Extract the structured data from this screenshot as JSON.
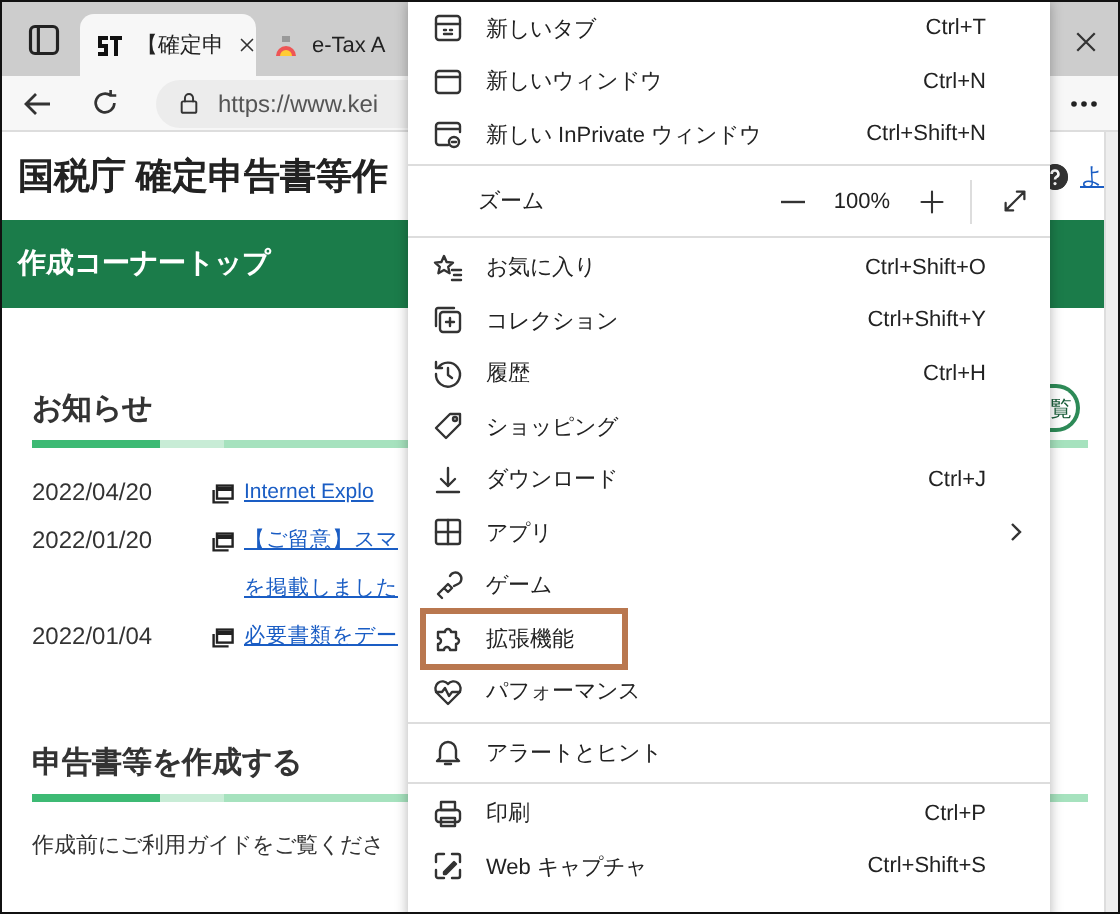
{
  "browser": {
    "tabs": [
      {
        "title": "【確定申",
        "selected": true
      },
      {
        "title": "e-Tax A",
        "selected": false
      }
    ],
    "url": "https://www.kei"
  },
  "page": {
    "title": "国税庁 確定申告書等作",
    "help_link": "よ",
    "banner": "作成コーナートップ",
    "news": {
      "heading": "お知らせ",
      "button": "覧",
      "items": [
        {
          "date": "2022/04/20",
          "lines": [
            "Internet Explo"
          ]
        },
        {
          "date": "2022/01/20",
          "lines": [
            "【ご留意】スマ",
            "を掲載しました"
          ]
        },
        {
          "date": "2022/01/04",
          "lines": [
            "必要書類をデー"
          ]
        }
      ]
    },
    "create": {
      "heading": "申告書等を作成する",
      "text": "作成前にご利用ガイドをご覧くださ"
    }
  },
  "menu": [
    {
      "kind": "item",
      "label": "新しいタブ",
      "shortcut": "Ctrl+T",
      "submenu": false,
      "highlighted": false
    },
    {
      "kind": "item",
      "label": "新しいウィンドウ",
      "shortcut": "Ctrl+N",
      "submenu": false,
      "highlighted": false
    },
    {
      "kind": "item",
      "label": "新しい InPrivate ウィンドウ",
      "shortcut": "Ctrl+Shift+N",
      "submenu": false,
      "highlighted": false
    },
    {
      "kind": "divider"
    },
    {
      "kind": "zoom",
      "label": "ズーム",
      "value": "100%"
    },
    {
      "kind": "divider"
    },
    {
      "kind": "item",
      "label": "お気に入り",
      "shortcut": "Ctrl+Shift+O",
      "submenu": false,
      "highlighted": false
    },
    {
      "kind": "item",
      "label": "コレクション",
      "shortcut": "Ctrl+Shift+Y",
      "submenu": false,
      "highlighted": false
    },
    {
      "kind": "item",
      "label": "履歴",
      "shortcut": "Ctrl+H",
      "submenu": false,
      "highlighted": false
    },
    {
      "kind": "item",
      "label": "ショッピング",
      "submenu": false,
      "highlighted": false
    },
    {
      "kind": "item",
      "label": "ダウンロード",
      "shortcut": "Ctrl+J",
      "submenu": false,
      "highlighted": false
    },
    {
      "kind": "item",
      "label": "アプリ",
      "submenu": true,
      "highlighted": false
    },
    {
      "kind": "item",
      "label": "ゲーム",
      "submenu": false,
      "highlighted": false
    },
    {
      "kind": "item",
      "label": "拡張機能",
      "submenu": false,
      "highlighted": true
    },
    {
      "kind": "item",
      "label": "パフォーマンス",
      "submenu": false,
      "highlighted": false
    },
    {
      "kind": "divider"
    },
    {
      "kind": "item",
      "label": "アラートとヒント",
      "submenu": false,
      "highlighted": false
    },
    {
      "kind": "divider"
    },
    {
      "kind": "item",
      "label": "印刷",
      "shortcut": "Ctrl+P",
      "submenu": false,
      "highlighted": false
    },
    {
      "kind": "item",
      "label": "Web キャプチャ",
      "shortcut": "Ctrl+Shift+S",
      "submenu": false,
      "highlighted": false
    }
  ]
}
